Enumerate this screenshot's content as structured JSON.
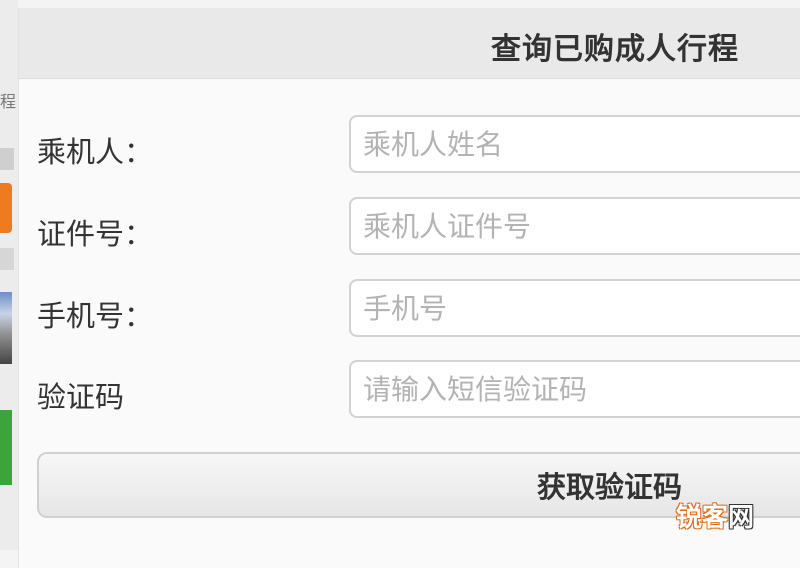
{
  "background": {
    "side_text": "程"
  },
  "dialog": {
    "title": "查询已购成人行程"
  },
  "form": {
    "passenger": {
      "label": "乘机人：",
      "placeholder": "乘机人姓名",
      "value": ""
    },
    "id_number": {
      "label": "证件号：",
      "placeholder": "乘机人证件号",
      "value": ""
    },
    "phone": {
      "label": "手机号：",
      "placeholder": "手机号",
      "value": ""
    },
    "sms_code": {
      "label": "验证码",
      "placeholder": "请输入短信验证码",
      "value": ""
    }
  },
  "actions": {
    "get_code_label": "获取验证码"
  },
  "watermark": {
    "part_a": "锐客",
    "part_b": "网"
  },
  "colors": {
    "header_bg": "#e9e9e9",
    "input_border": "#d2d2d2",
    "placeholder": "#b3b3b3",
    "accent_orange": "#f07a1e",
    "accent_green": "#3ba53b"
  }
}
